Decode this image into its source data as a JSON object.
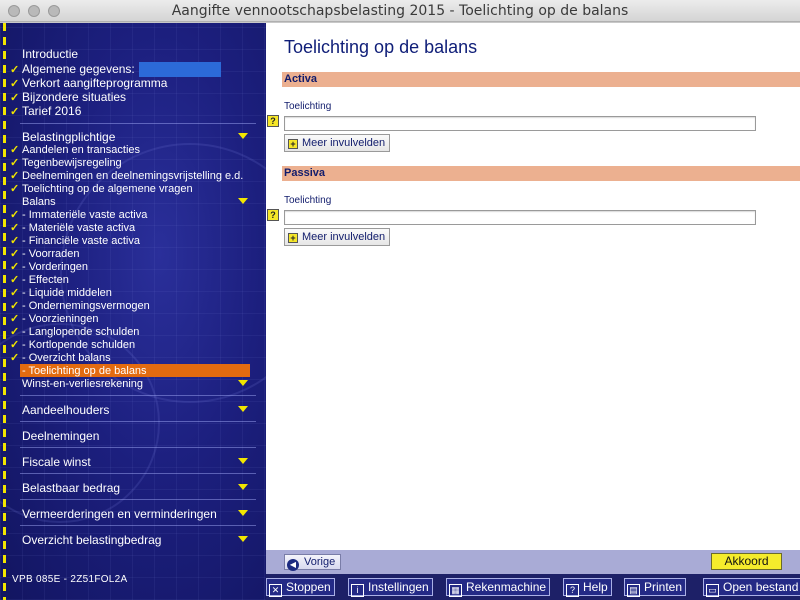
{
  "window": {
    "title": "Aangifte vennootschapsbelasting 2015 - Toelichting op de balans"
  },
  "sidebar": {
    "intro": "Introductie",
    "algemene": "Algemene gegevens:",
    "verkort": "Verkort aangifteprogramma",
    "bijzondere": "Bijzondere situaties",
    "tarief": "Tarief 2016",
    "belastingplichtige": "Belastingplichtige",
    "aandelen": "Aandelen en transacties",
    "tegenbewijs": "Tegenbewijsregeling",
    "deelnemingen_vrij": "Deelnemingen en deelnemingsvrijstelling e.d.",
    "toelichting_alg": "Toelichting op de algemene vragen",
    "balans": "Balans",
    "immateriele": "- Immateriële vaste activa",
    "materiele": "- Materiële vaste activa",
    "financiele": "- Financiële vaste activa",
    "voorraden": "- Voorraden",
    "vorderingen": "- Vorderingen",
    "effecten": "- Effecten",
    "liquide": "- Liquide middelen",
    "ondernemingsvermogen": "- Ondernemingsvermogen",
    "voorzieningen": "- Voorzieningen",
    "langlopende": "- Langlopende schulden",
    "kortlopende": "- Kortlopende schulden",
    "overzicht_balans": "- Overzicht balans",
    "toelichting_balans": "- Toelichting op de balans",
    "winst_verlies": "Winst-en-verliesrekening",
    "aandeelhouders": "Aandeelhouders",
    "deelnemingen": "Deelnemingen",
    "fiscale_winst": "Fiscale winst",
    "belastbaar": "Belastbaar bedrag",
    "vermeerderingen": "Vermeerderingen en verminderingen",
    "overzicht_belasting": "Overzicht belastingbedrag",
    "version": "VPB 085E - 2Z51FOL2A"
  },
  "main": {
    "heading": "Toelichting op de balans",
    "activa": {
      "title": "Activa",
      "label": "Toelichting",
      "value": "",
      "more": "Meer invulvelden"
    },
    "passiva": {
      "title": "Passiva",
      "label": "Toelichting",
      "value": "",
      "more": "Meer invulvelden"
    },
    "help_glyph": "?",
    "plus_glyph": "+"
  },
  "navbar": {
    "prev": "Vorige",
    "ok": "Akkoord"
  },
  "toolbar": {
    "stoppen": "Stoppen",
    "instellingen": "Instellingen",
    "rekenmachine": "Rekenmachine",
    "help": "Help",
    "printen": "Printen",
    "open": "Open bestand"
  },
  "colors": {
    "accent": "#f2e600",
    "selected": "#e36b10",
    "section": "#ecb090",
    "sidebar": "#1c1f7e"
  }
}
